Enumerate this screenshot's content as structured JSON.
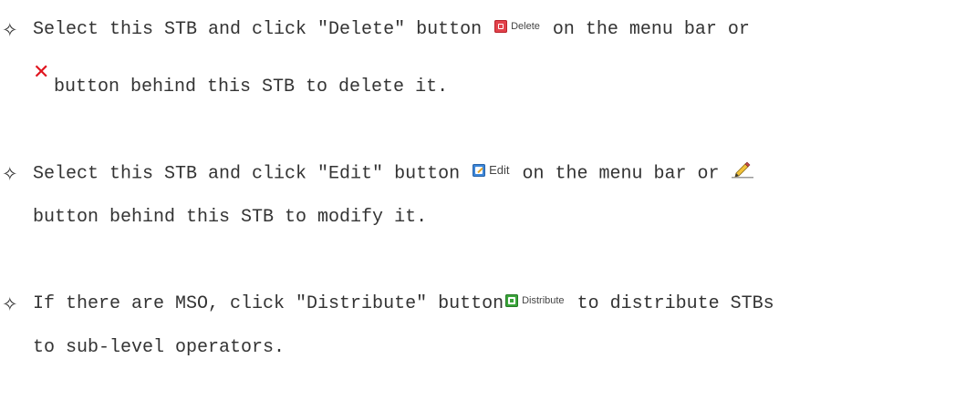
{
  "bullet_glyph": "✧",
  "items": [
    {
      "line1_before": "Select this STB and click ″Delete″ button ",
      "button_label": "Delete",
      "line1_after": " on the menu bar or",
      "line2_after": "button behind this STB to delete it."
    },
    {
      "line1_before": "Select this STB and click ″Edit″ button ",
      "button_label": "Edit",
      "line1_after": " on the menu bar or ",
      "line2_after": "button behind this STB to modify it."
    },
    {
      "line1_before": "If there are MSO, click ″Distribute″ button",
      "button_label": "Distribute",
      "line1_after": " to distribute STBs",
      "line2_after": "to sub-level operators."
    }
  ],
  "icons": {
    "delete_toolbar": "delete-icon",
    "delete_row": "x-icon",
    "edit_toolbar": "edit-icon",
    "edit_row": "pencil-icon",
    "distribute_toolbar": "distribute-icon"
  },
  "colors": {
    "text": "#333333",
    "delete_red": "#e2414a",
    "x_red": "#e0141e",
    "edit_blue": "#3d86d8",
    "distribute_green": "#3aa43a"
  }
}
